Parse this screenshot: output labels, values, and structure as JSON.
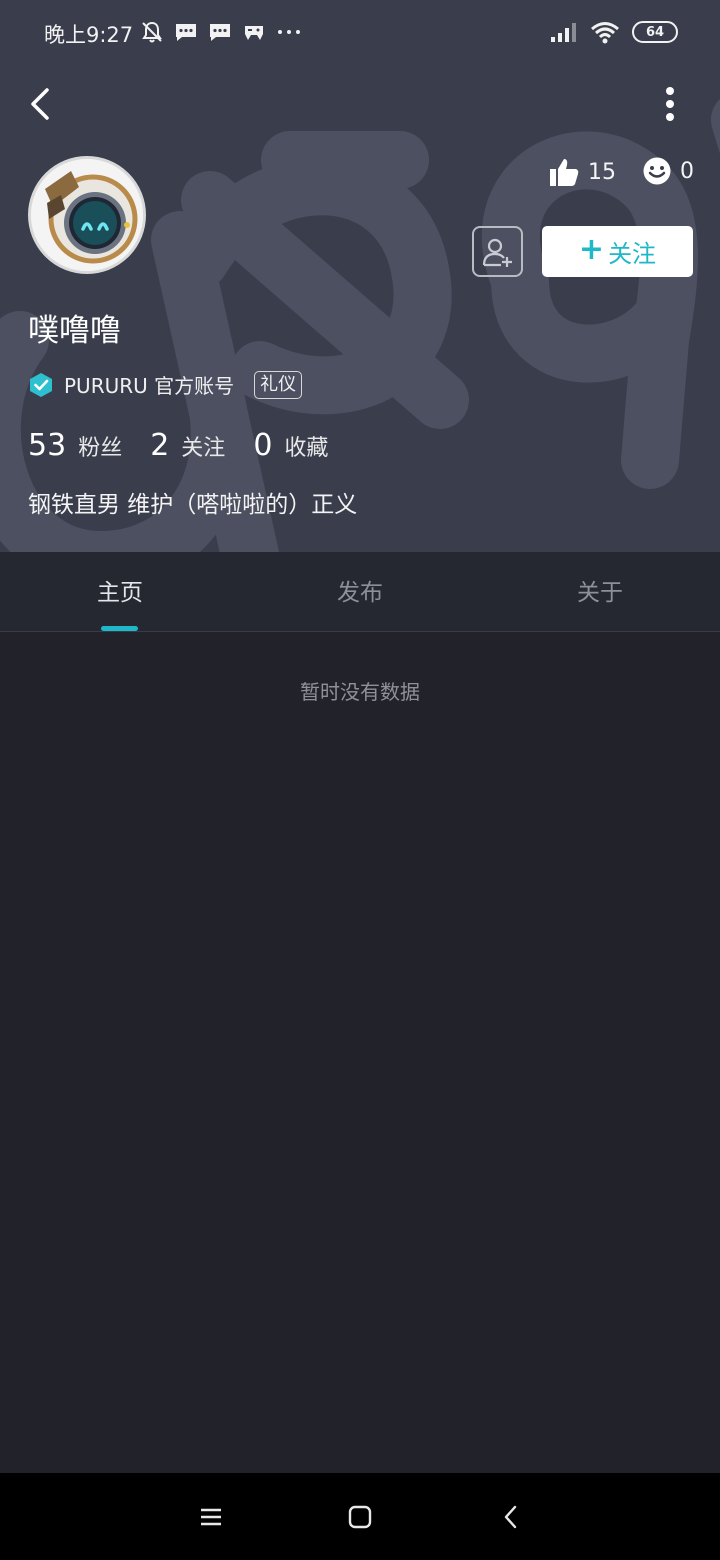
{
  "status_bar": {
    "time": "晚上9:27",
    "battery": "64",
    "icons_left": [
      "mute-icon",
      "message-icon",
      "message-icon",
      "game-icon",
      "more-dots-icon"
    ],
    "icons_right": [
      "signal-icon",
      "wifi-icon",
      "battery-icon"
    ]
  },
  "header": {
    "back_icon": "back-arrow-icon",
    "more_icon": "more-vertical-icon",
    "likes": "15",
    "emojis": "0",
    "follow_button": "关注",
    "add_friend_icon": "add-friend-icon"
  },
  "profile": {
    "username": "噗噜噜",
    "verified_text": "PURURU 官方账号",
    "tag": "礼仪",
    "fans_count": "53",
    "fans_label": "粉丝",
    "following_count": "2",
    "following_label": "关注",
    "favorites_count": "0",
    "favorites_label": "收藏",
    "bio": "钢铁直男 维护（嗒啦啦的）正义"
  },
  "tabs": [
    {
      "label": "主页",
      "active": true
    },
    {
      "label": "发布",
      "active": false
    },
    {
      "label": "关于",
      "active": false
    }
  ],
  "content": {
    "empty_message": "暂时没有数据"
  },
  "nav_bar": {
    "icons": [
      "menu-icon",
      "home-icon",
      "back-icon"
    ]
  },
  "colors": {
    "header_bg": "#3a3d4c",
    "page_bg": "#22222b",
    "accent": "#1fb8c8"
  }
}
